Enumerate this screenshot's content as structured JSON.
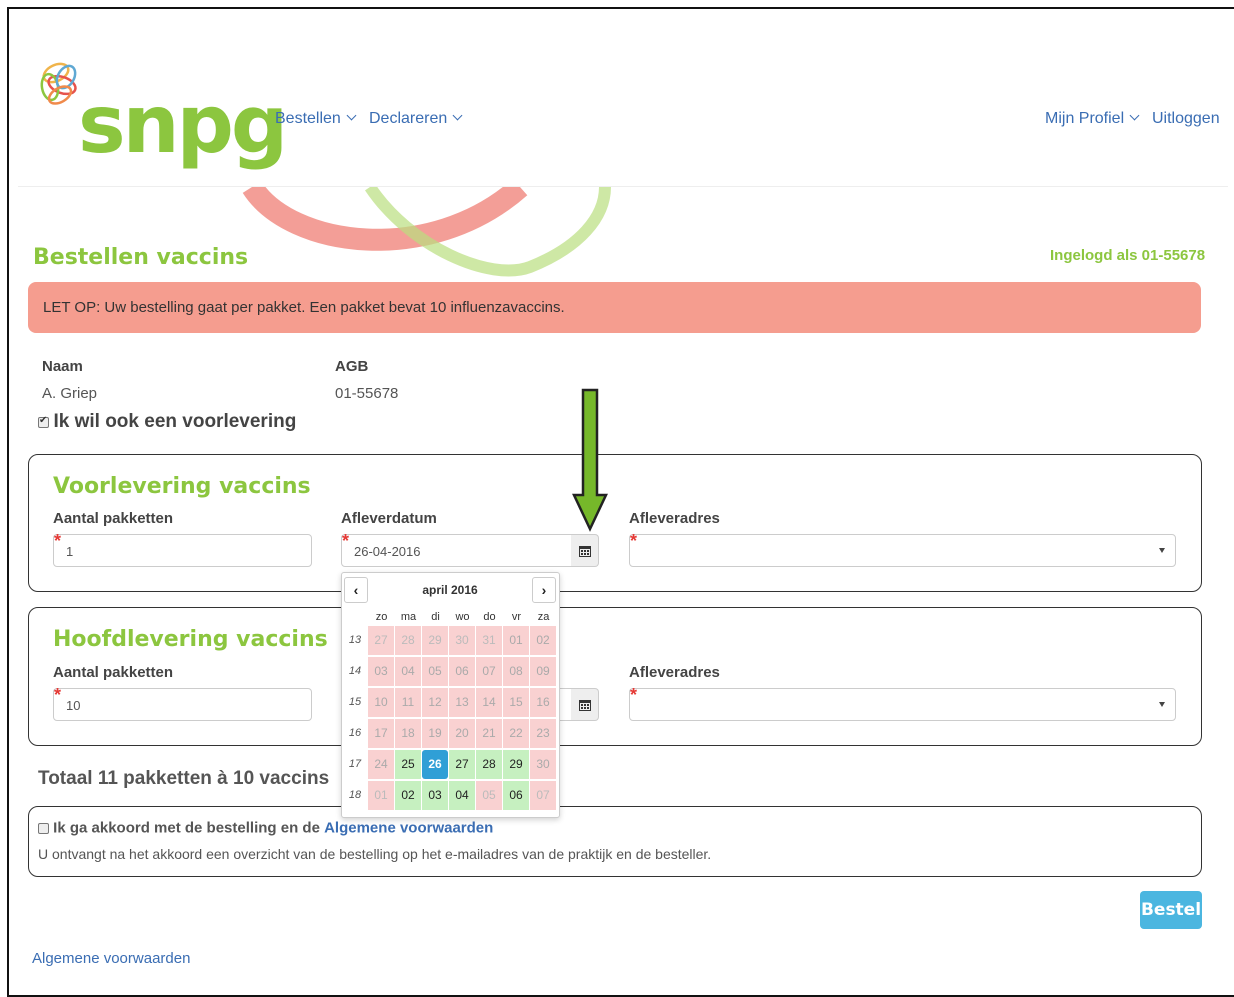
{
  "brand": {
    "name": "snpg"
  },
  "nav": {
    "left": [
      {
        "label": "Bestellen"
      },
      {
        "label": "Declareren"
      }
    ],
    "profile": "Mijn Profiel",
    "logout": "Uitloggen"
  },
  "page": {
    "title": "Bestellen vaccins",
    "logged_in": "Ingelogd als 01-55678",
    "alert": "LET OP: Uw bestelling gaat per pakket. Een pakket bevat 10 influenzavaccins."
  },
  "info": {
    "name_label": "Naam",
    "name_value": "A. Griep",
    "agb_label": "AGB",
    "agb_value": "01-55678",
    "voorlevering_checkbox": "Ik wil ook een voorlevering"
  },
  "voorlevering": {
    "title": "Voorlevering vaccins",
    "aantal_label": "Aantal pakketten",
    "aantal_value": "1",
    "datum_label": "Afleverdatum",
    "datum_value": "26-04-2016",
    "adres_label": "Afleveradres"
  },
  "hoofdlevering": {
    "title": "Hoofdlevering vaccins",
    "aantal_label": "Aantal pakketten",
    "aantal_value": "10",
    "adres_label": "Afleveradres"
  },
  "datepicker": {
    "month": "april 2016",
    "weekdays": [
      "zo",
      "ma",
      "di",
      "wo",
      "do",
      "vr",
      "za"
    ],
    "weeks": [
      {
        "nr": "13",
        "days": [
          "27",
          "28",
          "29",
          "30",
          "31",
          "01",
          "02"
        ]
      },
      {
        "nr": "14",
        "days": [
          "03",
          "04",
          "05",
          "06",
          "07",
          "08",
          "09"
        ]
      },
      {
        "nr": "15",
        "days": [
          "10",
          "11",
          "12",
          "13",
          "14",
          "15",
          "16"
        ]
      },
      {
        "nr": "16",
        "days": [
          "17",
          "18",
          "19",
          "20",
          "21",
          "22",
          "23"
        ]
      },
      {
        "nr": "17",
        "days": [
          "24",
          "25",
          "26",
          "27",
          "28",
          "29",
          "30"
        ]
      },
      {
        "nr": "18",
        "days": [
          "01",
          "02",
          "03",
          "04",
          "05",
          "06",
          "07"
        ]
      }
    ],
    "selected_day": "26",
    "available_days": [
      "25",
      "27",
      "28",
      "29",
      "02",
      "03",
      "04",
      "06"
    ]
  },
  "totals": {
    "text": "Totaal 11 pakketten à 10 vaccins"
  },
  "terms": {
    "checkbox_label": "Ik ga akkoord met de bestelling en de",
    "link": "Algemene voorwaarden",
    "note": "U ontvangt na het akkoord een overzicht van de bestelling op het e-mailadres van de praktijk en de besteller."
  },
  "order_button": "Bestel",
  "footer_link": "Algemene voorwaarden",
  "colors": {
    "brand_green": "#8cc63f",
    "alert_bg": "#f59d8f",
    "link": "#3a6db3",
    "selected": "#2f9fd6"
  }
}
